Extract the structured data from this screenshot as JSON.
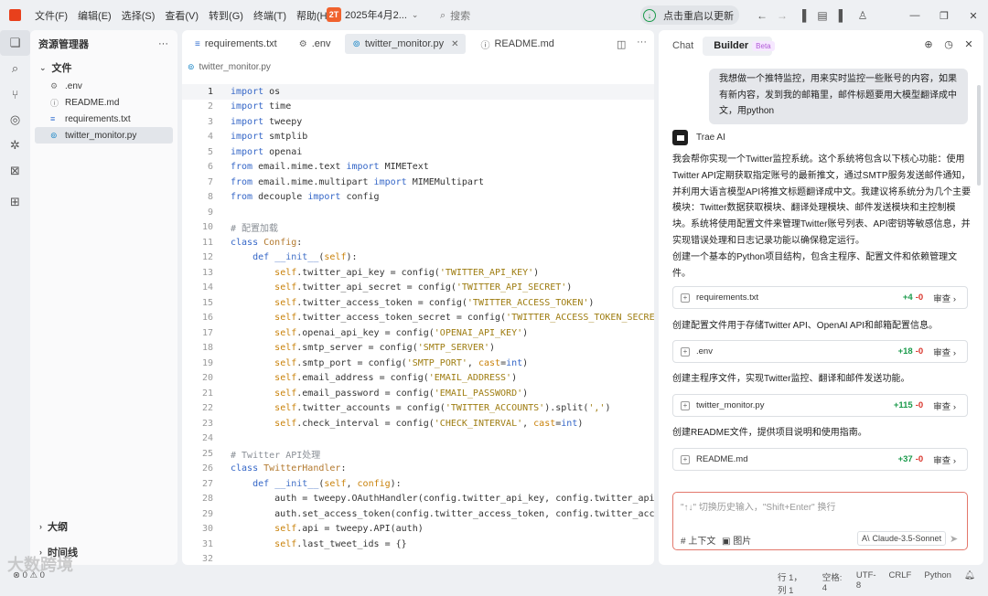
{
  "menu": [
    "文件(F)",
    "编辑(E)",
    "选择(S)",
    "查看(V)",
    "转到(G)",
    "终端(T)",
    "帮助(H)"
  ],
  "project": {
    "badge": "2T",
    "name": "2025年4月2..."
  },
  "search": {
    "label": "搜索"
  },
  "update": {
    "label": "点击重启以更新"
  },
  "explorer": {
    "title": "资源管理器",
    "section": "文件",
    "files": [
      {
        "icon": "⚙",
        "name": ".env"
      },
      {
        "icon": "ⓘ",
        "name": "README.md"
      },
      {
        "icon": "≡",
        "name": "requirements.txt"
      },
      {
        "icon": "⊚",
        "name": "twitter_monitor.py"
      }
    ],
    "outline": "大纲",
    "timeline": "时间线"
  },
  "tabs": [
    {
      "icon": "≡",
      "label": "requirements.txt"
    },
    {
      "icon": "⚙",
      "label": ".env"
    },
    {
      "icon": "⊚",
      "label": "twitter_monitor.py"
    },
    {
      "icon": "ⓘ",
      "label": "README.md"
    }
  ],
  "breadcrumb": "twitter_monitor.py",
  "code_lines": [
    {
      "n": "1",
      "h": "<span class=\"kw\">import</span> os"
    },
    {
      "n": "2",
      "h": "<span class=\"kw\">import</span> time"
    },
    {
      "n": "3",
      "h": "<span class=\"kw\">import</span> tweepy"
    },
    {
      "n": "4",
      "h": "<span class=\"kw\">import</span> smtplib"
    },
    {
      "n": "5",
      "h": "<span class=\"kw\">import</span> openai"
    },
    {
      "n": "6",
      "h": "<span class=\"kw\">from</span> email.mime.text <span class=\"kw\">import</span> MIMEText"
    },
    {
      "n": "7",
      "h": "<span class=\"kw\">from</span> email.mime.multipart <span class=\"kw\">import</span> MIMEMultipart"
    },
    {
      "n": "8",
      "h": "<span class=\"kw\">from</span> decouple <span class=\"kw\">import</span> config"
    },
    {
      "n": "9",
      "h": ""
    },
    {
      "n": "10",
      "h": "<span class=\"cm\"># 配置加载</span>"
    },
    {
      "n": "11",
      "h": "<span class=\"kw\">class</span> <span class=\"cls\">Config</span>:"
    },
    {
      "n": "12",
      "h": "    <span class=\"kw\">def</span> <span class=\"fn\">__init__</span>(<span class=\"sf\">self</span>):"
    },
    {
      "n": "13",
      "h": "        <span class=\"sf\">self</span>.twitter_api_key = config(<span class=\"st\">'TWITTER_API_KEY'</span>)"
    },
    {
      "n": "14",
      "h": "        <span class=\"sf\">self</span>.twitter_api_secret = config(<span class=\"st\">'TWITTER_API_SECRET'</span>)"
    },
    {
      "n": "15",
      "h": "        <span class=\"sf\">self</span>.twitter_access_token = config(<span class=\"st\">'TWITTER_ACCESS_TOKEN'</span>)"
    },
    {
      "n": "16",
      "h": "        <span class=\"sf\">self</span>.twitter_access_token_secret = config(<span class=\"st\">'TWITTER_ACCESS_TOKEN_SECRET'</span>)"
    },
    {
      "n": "17",
      "h": "        <span class=\"sf\">self</span>.openai_api_key = config(<span class=\"st\">'OPENAI_API_KEY'</span>)"
    },
    {
      "n": "18",
      "h": "        <span class=\"sf\">self</span>.smtp_server = config(<span class=\"st\">'SMTP_SERVER'</span>)"
    },
    {
      "n": "19",
      "h": "        <span class=\"sf\">self</span>.smtp_port = config(<span class=\"st\">'SMTP_PORT'</span>, <span class=\"sf\">cast</span>=<span class=\"kw\">int</span>)"
    },
    {
      "n": "20",
      "h": "        <span class=\"sf\">self</span>.email_address = config(<span class=\"st\">'EMAIL_ADDRESS'</span>)"
    },
    {
      "n": "21",
      "h": "        <span class=\"sf\">self</span>.email_password = config(<span class=\"st\">'EMAIL_PASSWORD'</span>)"
    },
    {
      "n": "22",
      "h": "        <span class=\"sf\">self</span>.twitter_accounts = config(<span class=\"st\">'TWITTER_ACCOUNTS'</span>).split(<span class=\"st\">','</span>)"
    },
    {
      "n": "23",
      "h": "        <span class=\"sf\">self</span>.check_interval = config(<span class=\"st\">'CHECK_INTERVAL'</span>, <span class=\"sf\">cast</span>=<span class=\"kw\">int</span>)"
    },
    {
      "n": "24",
      "h": ""
    },
    {
      "n": "25",
      "h": "<span class=\"cm\"># Twitter API处理</span>"
    },
    {
      "n": "26",
      "h": "<span class=\"kw\">class</span> <span class=\"cls\">TwitterHandler</span>:"
    },
    {
      "n": "27",
      "h": "    <span class=\"kw\">def</span> <span class=\"fn\">__init__</span>(<span class=\"sf\">self</span>, <span class=\"sf\">config</span>):"
    },
    {
      "n": "28",
      "h": "        auth = tweepy.OAuthHandler(config.twitter_api_key, config.twitter_api_s"
    },
    {
      "n": "29",
      "h": "        auth.set_access_token(config.twitter_access_token, config.twitter_acces"
    },
    {
      "n": "30",
      "h": "        <span class=\"sf\">self</span>.api = tweepy.API(auth)"
    },
    {
      "n": "31",
      "h": "        <span class=\"sf\">self</span>.last_tweet_ids = {}"
    },
    {
      "n": "32",
      "h": ""
    }
  ],
  "panel": {
    "tab_chat": "Chat",
    "tab_builder": "Builder",
    "beta": "Beta",
    "user_message": "我想做一个推特监控，用来实时监控一些账号的内容，如果有新内容，发到我的邮箱里，邮件标题要用大模型翻译成中文，用python",
    "ai_name": "Trae AI",
    "intro": "我会帮你实现一个Twitter监控系统。这个系统将包含以下核心功能：使用Twitter API定期获取指定账号的最新推文，通过SMTP服务发送邮件通知，并利用大语言模型API将推文标题翻译成中文。我建议将系统分为几个主要模块：Twitter数据获取模块、翻译处理模块、邮件发送模块和主控制模块。系统将使用配置文件来管理Twitter账号列表、API密钥等敏感信息，并实现错误处理和日志记录功能以确保稳定运行。",
    "steps": [
      {
        "text": "创建一个基本的Python项目结构，包含主程序、配置文件和依赖管理文件。",
        "file": "requirements.txt",
        "add": "+4",
        "del": "-0"
      },
      {
        "text": "创建配置文件用于存储Twitter API、OpenAI API和邮箱配置信息。",
        "file": ".env",
        "add": "+18",
        "del": "-0"
      },
      {
        "text": "创建主程序文件，实现Twitter监控、翻译和邮件发送功能。",
        "file": "twitter_monitor.py",
        "add": "+115",
        "del": "-0"
      },
      {
        "text": "创建README文件，提供项目说明和使用指南。",
        "file": "README.md",
        "add": "+37",
        "del": "-0"
      }
    ],
    "review": "审查",
    "input_placeholder": "\"↑↓\" 切换历史输入，\"Shift+Enter\" 换行",
    "ctx": "# 上下文",
    "image": "图片",
    "model": "Claude-3.5-Sonnet"
  },
  "status": {
    "left": "⊗ 0 ⚠ 0",
    "items": [
      "行 1，列 1",
      "空格: 4",
      "UTF-8",
      "CRLF",
      "Python"
    ]
  },
  "watermark": "大数跨境"
}
